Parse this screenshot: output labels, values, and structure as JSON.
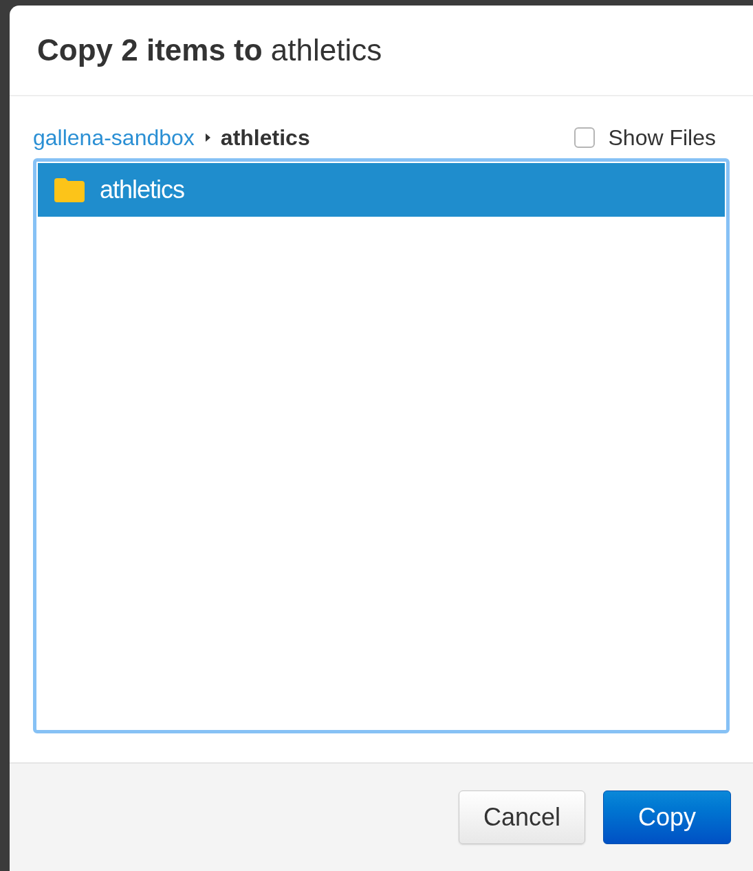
{
  "dialog": {
    "title": "**Copy 2 items to** athletics"
  },
  "breadcrumb": [
    {
      "label": "gallena-sandbox",
      "kind": "link"
    },
    {
      "label": "athletics",
      "kind": "current"
    }
  ],
  "show_files": {
    "label": "Show Files",
    "checked": false
  },
  "folders": [
    {
      "name": "athletics",
      "selected": true
    }
  ],
  "buttons": [
    {
      "label": "Cancel",
      "kind": "secondary"
    },
    {
      "label": "Copy",
      "kind": "primary"
    }
  ]
}
